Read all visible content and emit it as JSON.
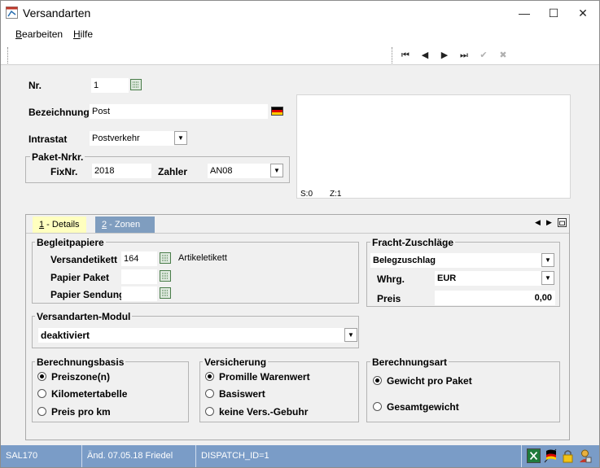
{
  "window": {
    "title": "Versandarten",
    "minimize_glyph": "—",
    "maximize_glyph": "☐",
    "close_glyph": "✕"
  },
  "menu": {
    "items": [
      {
        "label": "Bearbeiten",
        "accel": "B",
        "rest": "earbeiten"
      },
      {
        "label": "Hilfe",
        "accel": "H",
        "rest": "ilfe"
      }
    ]
  },
  "toolbar": {
    "first_glyph": "⏮",
    "prev_glyph": "◀",
    "next_glyph": "▶",
    "last_glyph": "⏭",
    "ok_glyph": "✔",
    "cancel_glyph": "✖"
  },
  "header": {
    "nr_label": "Nr.",
    "nr_value": "1",
    "bezeichnung_label": "Bezeichnung",
    "bezeichnung_value": "Post",
    "intrastat_label": "Intrastat",
    "intrastat_value": "Postverkehr",
    "paket_group_title": "Paket-Nrkr.",
    "fixnr_label": "FixNr.",
    "fixnr_value": "2018",
    "zahler_label": "Zahler",
    "zahler_value": "AN08",
    "memo_status_s": "S:0",
    "memo_status_z": "Z:1"
  },
  "tabs": [
    {
      "label": "1 - Details",
      "accel": "1",
      "rest": " - Details",
      "active": true
    },
    {
      "label": "2 - Zonen",
      "accel": "2",
      "rest": " - Zonen",
      "active": false
    }
  ],
  "details": {
    "begleitpapiere": {
      "title": "Begleitpapiere",
      "versandetikett_label": "Versandetikett",
      "versandetikett_value": "164",
      "versandetikett_desc": "Artikeletikett",
      "papier_paket_label": "Papier Paket",
      "papier_paket_value": "",
      "papier_sendung_label": "Papier Sendung",
      "papier_sendung_value": ""
    },
    "fracht": {
      "title": "Fracht-Zuschläge",
      "zuschlag_value": "Belegzuschlag",
      "whrg_label": "Whrg.",
      "whrg_value": "EUR",
      "preis_label": "Preis",
      "preis_value": "0,00"
    },
    "modul": {
      "title": "Versandarten-Modul",
      "value": "deaktiviert"
    },
    "berechnungsbasis": {
      "title": "Berechnungsbasis",
      "options": [
        "Preiszone(n)",
        "Kilometertabelle",
        "Preis pro km"
      ],
      "selected": 0
    },
    "versicherung": {
      "title": "Versicherung",
      "options": [
        "Promille Warenwert",
        "Basiswert",
        "keine Vers.-Gebuhr"
      ],
      "selected": 0
    },
    "berechnungsart": {
      "title": "Berechnungsart",
      "options": [
        "Gewicht pro Paket",
        "Gesamtgewicht"
      ],
      "selected": 0
    }
  },
  "status": {
    "module": "SAL170",
    "changed": "Änd. 07.05.18 Friedel",
    "record": "DISPATCH_ID=1"
  }
}
